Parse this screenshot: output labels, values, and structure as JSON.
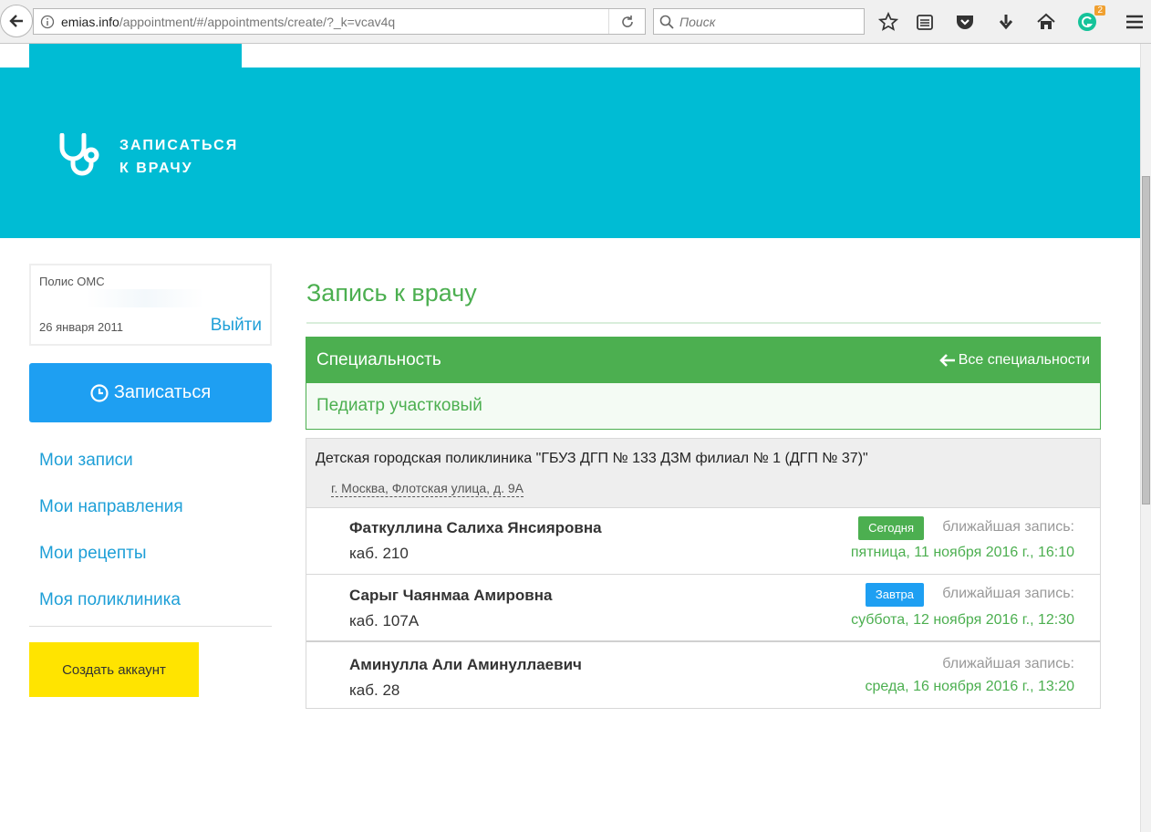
{
  "browser": {
    "url_host": "emias.info",
    "url_path": "/appointment/#/appointments/create/?_k=vcav4q",
    "search_placeholder": "Поиск",
    "badge_count": "2"
  },
  "header": {
    "logo_line1": "ЗАПИСАТЬСЯ",
    "logo_line2": "К ВРАЧУ"
  },
  "sidebar": {
    "policy_label": "Полис ОМС",
    "policy_date": "26 января 2011",
    "logout_label": "Выйти",
    "book_label": "Записаться",
    "nav": [
      {
        "label": "Мои записи"
      },
      {
        "label": "Мои направления"
      },
      {
        "label": "Мои рецепты"
      },
      {
        "label": "Моя поликлиника"
      }
    ],
    "create_account_label": "Создать аккаунт"
  },
  "main": {
    "title": "Запись к врачу",
    "specialty_header": "Специальность",
    "all_specialties_label": "Все специальности",
    "specialty_value": "Педиатр участковый",
    "clinic": {
      "name": "Детская городская поликлиника \"ГБУЗ ДГП № 133 ДЗМ филиал № 1 (ДГП № 37)\"",
      "address": "г. Москва, Флотская улица, д. 9А"
    },
    "doctors": [
      {
        "name": "Фаткуллина Салиха Янсияровна",
        "room": "каб. 210",
        "badge": "Сегодня",
        "badge_color": "#4caf50",
        "near_label": "ближайшая запись:",
        "near_date": "пятница, 11 ноября 2016 г., 16:10"
      },
      {
        "name": "Сарыг Чаянмаа Амировна",
        "room": "каб. 107А",
        "badge": "Завтра",
        "badge_color": "#1e9ff2",
        "near_label": "ближайшая запись:",
        "near_date": "суббота, 12 ноября 2016 г., 12:30"
      },
      {
        "name": "Аминулла Али Аминуллаевич",
        "room": "каб. 28",
        "badge": "",
        "badge_color": "",
        "near_label": "ближайшая запись:",
        "near_date": "среда, 16 ноября 2016 г., 13:20"
      }
    ]
  },
  "colors": {
    "brand_cyan": "#00bcd4",
    "accent_green": "#4caf50",
    "link_blue": "#1e9fd7",
    "button_blue": "#1e9ff2",
    "create_yellow": "#ffe400"
  }
}
